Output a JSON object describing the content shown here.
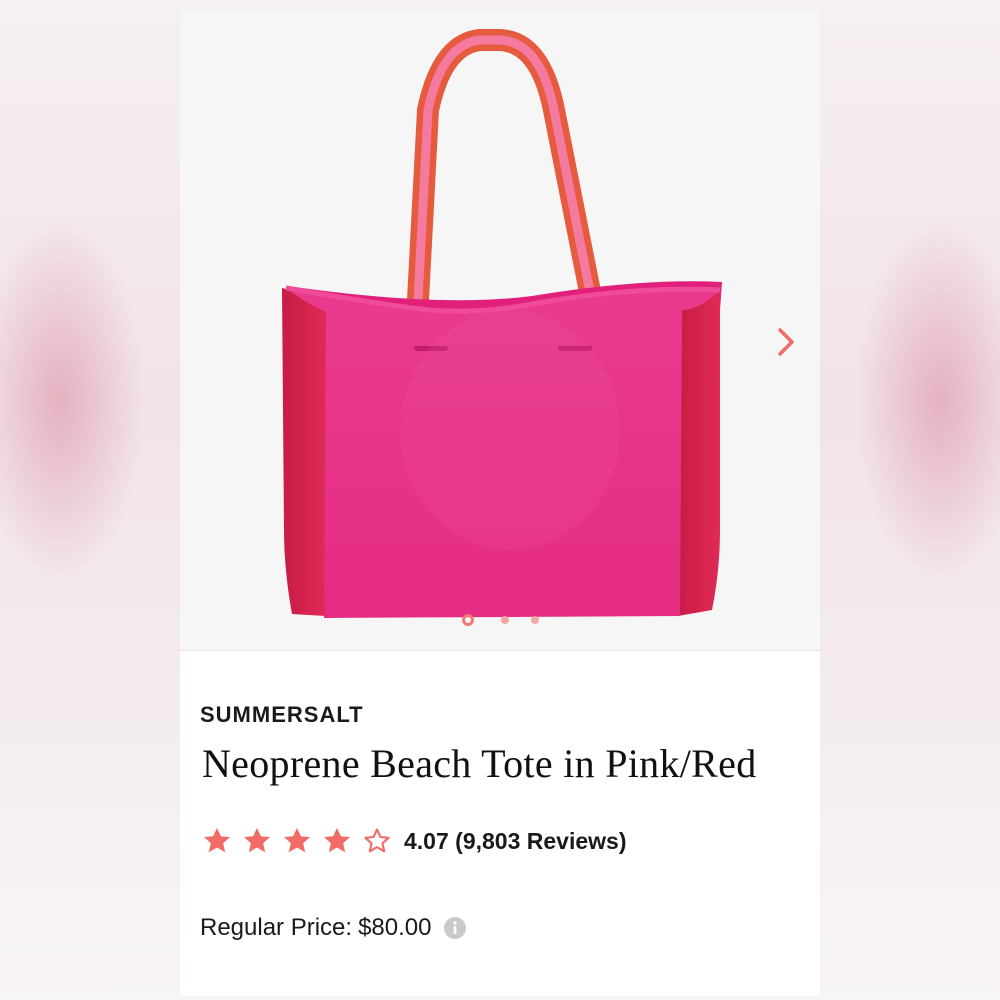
{
  "product": {
    "brand": "SUMMERSALT",
    "title": "Neoprene Beach Tote in Pink/Red",
    "rating": 4.07,
    "rating_display": "4.07 (9,803 Reviews)",
    "stars_filled": 4,
    "stars_total": 5,
    "price_label": "Regular Price:",
    "price_value": "$80.00"
  },
  "gallery": {
    "image_count": 3,
    "active_index": 1,
    "next_icon": "chevron-right-icon"
  },
  "colors": {
    "accent": "#f26b66",
    "bag_body": "#e8338a",
    "bag_side": "#d8254a",
    "strap_pink": "#f27aa0",
    "strap_orange": "#e8573c"
  }
}
